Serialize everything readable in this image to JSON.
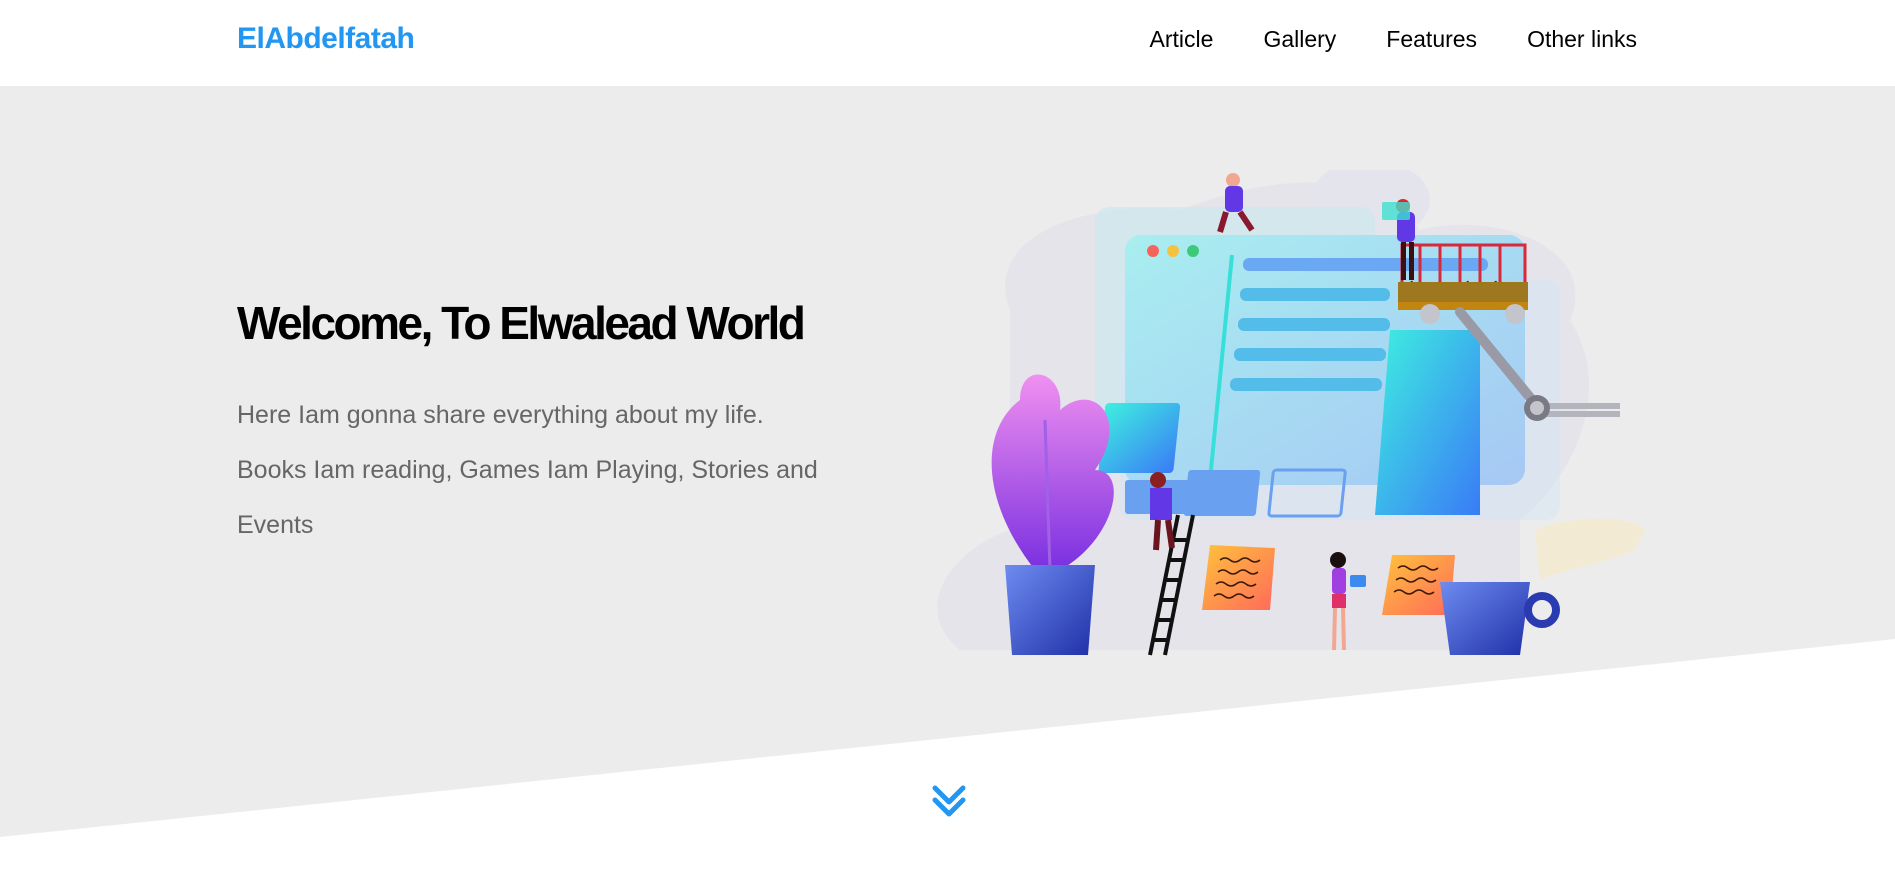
{
  "header": {
    "logo": "ElAbdelfatah",
    "nav": [
      {
        "label": "Article"
      },
      {
        "label": "Gallery"
      },
      {
        "label": "Features"
      },
      {
        "label": "Other links"
      }
    ]
  },
  "hero": {
    "title": "Welcome, To Elwalead World",
    "text_line1": "Here Iam gonna share everything about my life.",
    "text_line2": "Books Iam reading, Games Iam Playing, Stories and Events"
  },
  "colors": {
    "accent": "#2196f3",
    "hero_bg": "#ececec",
    "text_muted": "#666666"
  },
  "icons": {
    "scroll_down": "double-chevron-down-icon"
  }
}
